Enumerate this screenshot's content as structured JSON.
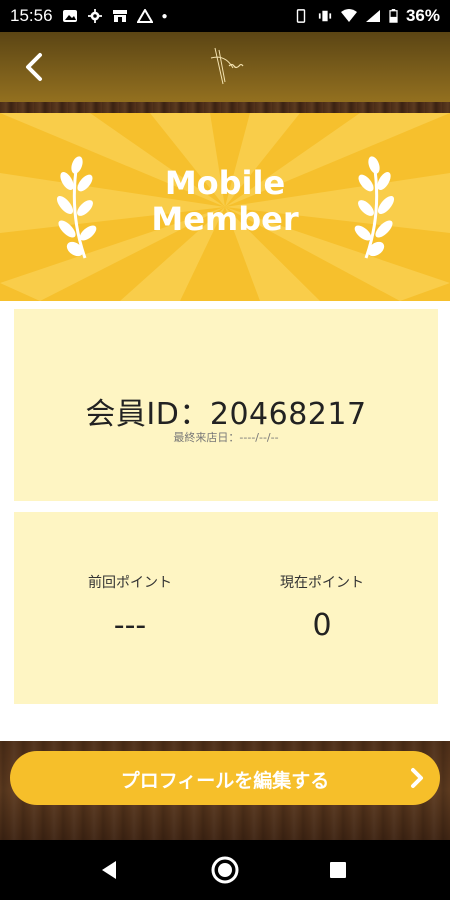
{
  "status_bar": {
    "time": "15:56",
    "battery": "36%"
  },
  "header": {
    "back_icon": "chevron-left-icon",
    "logo": "ryokan-logo"
  },
  "banner": {
    "title_line1": "Mobile",
    "title_line2": "Member"
  },
  "member": {
    "id_text": "会員ID：20468217",
    "last_visit_text": "最終来店日：----/--/--"
  },
  "points": {
    "previous_label": "前回ポイント",
    "previous_value": "---",
    "current_label": "現在ポイント",
    "current_value": "0"
  },
  "actions": {
    "edit_profile_label": "プロフィールを編集する"
  },
  "colors": {
    "accent": "#f6bf2a",
    "card": "#fef5c3",
    "header": "#7a5d1b",
    "wood": "#4d2e18"
  }
}
